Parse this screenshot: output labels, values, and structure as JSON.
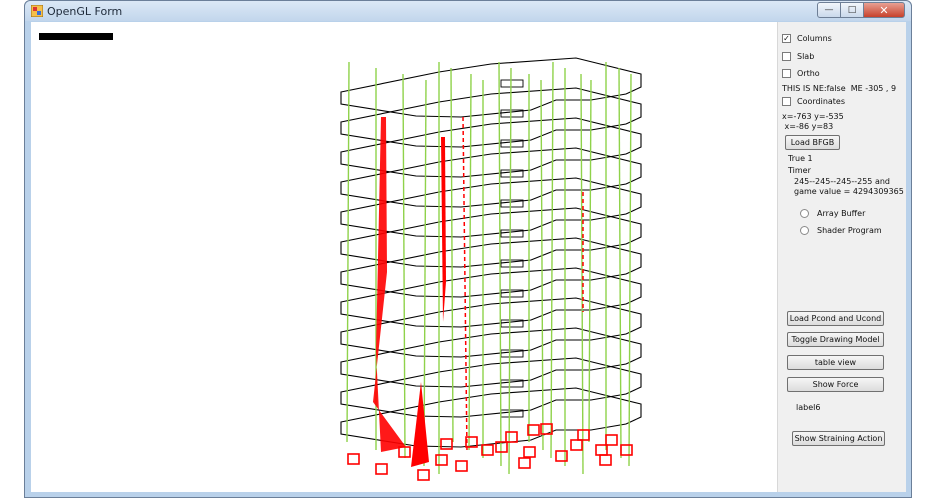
{
  "window": {
    "title": "OpenGL Form"
  },
  "panel": {
    "checkboxes": [
      {
        "label": "Columns",
        "checked": true
      },
      {
        "label": "Slab",
        "checked": false
      },
      {
        "label": "Ortho",
        "checked": false
      },
      {
        "label": "Coordinates",
        "checked": false
      }
    ],
    "status_text": "THIS IS NE:false  ME -305 , 9",
    "coords_line1": "x=-763 y=-535",
    "coords_line2": " x=-86 y=83",
    "load_button": "Load BFGB",
    "true_label": "True 1",
    "timer_label": "Timer",
    "color_line": "245--245--245--255 and",
    "game_value_line": "game value = 4294309365",
    "radios": [
      {
        "label": "Array Buffer",
        "selected": false
      },
      {
        "label": "Shader Program",
        "selected": false
      }
    ],
    "buttons": {
      "load_pcond": "Load Pcond and Ucond",
      "toggle_drawing": "Toggle Drawing Model",
      "table_view": "table view",
      "show_force": "Show Force",
      "show_straining": "Show Straining Action"
    },
    "label6": "label6"
  },
  "colors": {
    "column": "#8fd24a",
    "force": "#ff0000",
    "slab": "#000000"
  }
}
